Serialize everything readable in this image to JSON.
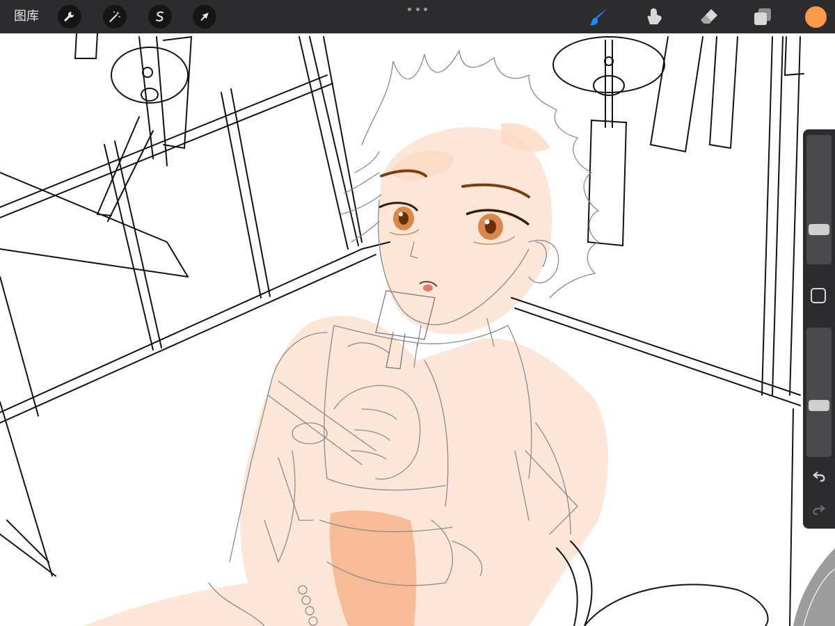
{
  "toolbar": {
    "gallery_label": "图库",
    "left_tools": [
      "wrench-icon",
      "magic-wand-icon",
      "selection-s-icon",
      "transform-arrow-icon"
    ],
    "right_tools": [
      "brush-icon",
      "smudge-icon",
      "eraser-icon",
      "layers-icon"
    ],
    "brush_active_color": "#1a8cff",
    "current_color": "#ff9a4d"
  },
  "sidebar": {
    "brush_size_level": 0.78,
    "opacity_level": 0.6,
    "icons": [
      "modify-square-icon",
      "undo-icon",
      "redo-icon"
    ]
  },
  "colors": {
    "toolbar_bg": "#2c2c2e",
    "skin": "#fde3d3",
    "iris": "#c9743c"
  }
}
